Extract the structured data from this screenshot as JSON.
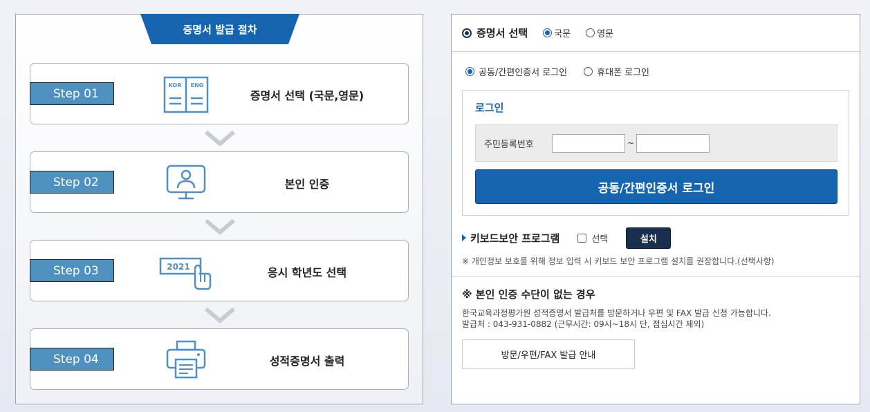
{
  "procedure": {
    "header": "증명서 발급 절차",
    "steps": [
      {
        "label": "Step 01",
        "text": "증명서 선택 (국문,영문)",
        "icon": "document-kor-eng-icon"
      },
      {
        "label": "Step 02",
        "text": "본인 인증",
        "icon": "monitor-user-icon"
      },
      {
        "label": "Step 03",
        "text": "응시 학년도 선택",
        "icon": "year-select-hand-icon"
      },
      {
        "label": "Step 04",
        "text": "성적증명서 출력",
        "icon": "printer-icon"
      }
    ],
    "icon_text": {
      "kor": "KOR",
      "eng": "ENG",
      "year": "2021"
    }
  },
  "certificate": {
    "title": "증명서 선택",
    "options": [
      {
        "label": "국문",
        "selected": true
      },
      {
        "label": "영문",
        "selected": false
      }
    ]
  },
  "login_method": {
    "options": [
      {
        "label": "공동/간편인증서 로그인",
        "selected": true
      },
      {
        "label": "휴대폰 로그인",
        "selected": false
      }
    ]
  },
  "login": {
    "title": "로그인",
    "id_label": "주민등록번호",
    "id_first": "",
    "id_second": "",
    "separator": "~",
    "button": "공동/간편인증서 로그인"
  },
  "keyboard": {
    "title": "키보드보안 프로그램",
    "check_label": "선택",
    "checked": false,
    "install_button": "설치",
    "note": "※ 개인정보 보호를 위해 정보 입력 시 키보드 보안 프로그램 설치를 권장합니다.(선택사항)"
  },
  "no_auth": {
    "title": "※ 본인 인증 수단이 없는 경우",
    "line1": "한국교육과정평가원 성적증명서 발급처를 방문하거나 우편 및 FAX 발급 신청 가능합니다.",
    "line2": "발급처 : 043-931-0882 (근무시간: 09시~18시 단, 점심시간 제외)",
    "button": "방문/우편/FAX 발급 안내"
  },
  "colors": {
    "primary": "#1564b0",
    "step_label": "#4e90bf",
    "install": "#1a2f4e",
    "chevron": "#c9cbd0",
    "icon": "#4f8fc4"
  }
}
